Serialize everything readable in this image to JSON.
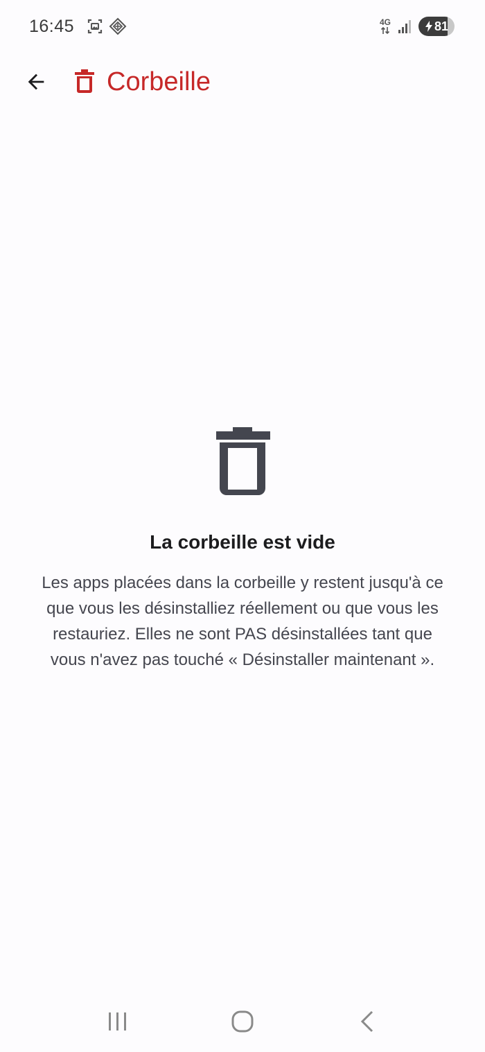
{
  "status_bar": {
    "time": "16:45",
    "network": "4G",
    "battery_level": "81",
    "icons": [
      "screenshot-icon",
      "vpn-shield-icon",
      "network-arrows-icon",
      "signal-icon",
      "battery-charging-icon"
    ]
  },
  "app_bar": {
    "title": "Corbeille",
    "back_icon": "arrow-back-icon",
    "title_icon": "trash-icon"
  },
  "empty_state": {
    "icon": "trash-icon",
    "title": "La corbeille est vide",
    "description": "Les apps placées dans la corbeille y restent jusqu'à ce que vous les désinstalliez réellement ou que vous les restauriez. Elles ne sont PAS désinstallées tant que vous n'avez pas touché « Désinstaller maintenant »."
  },
  "nav_bar": {
    "icons": [
      "recents-icon",
      "home-icon",
      "back-icon"
    ]
  },
  "colors": {
    "accent": "#c62828",
    "background": "#fdfcfe",
    "icon_dark": "#44464f",
    "text_primary": "#1c1c1e",
    "text_secondary": "#45464f"
  }
}
